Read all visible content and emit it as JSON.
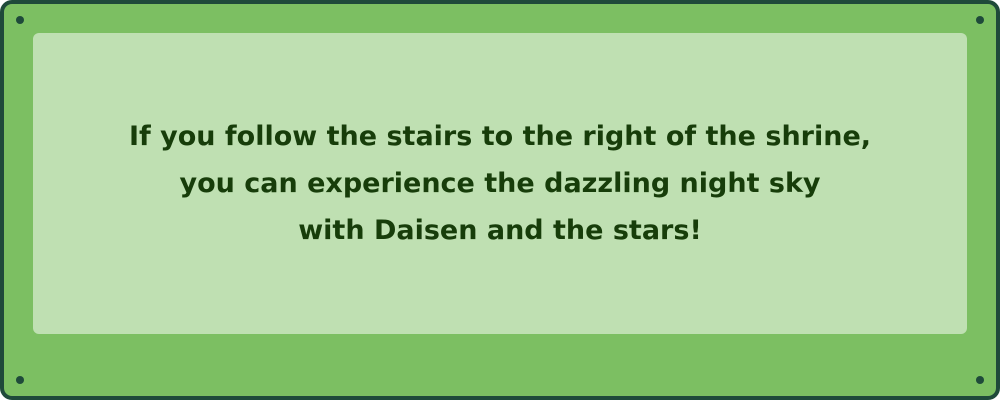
{
  "sign": {
    "lines": [
      "If you follow the stairs to the right of the shrine,",
      "you can experience the dazzling night sky",
      "with Daisen and the stars!"
    ]
  },
  "colors": {
    "frame": "#7cbf62",
    "border": "#1f4a3a",
    "panel": "#bfe0b2",
    "text": "#173d0a"
  }
}
